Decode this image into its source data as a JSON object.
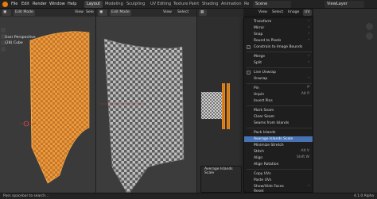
{
  "topbar": {
    "menus": [
      "File",
      "Edit",
      "Render",
      "Window",
      "Help"
    ],
    "workspaces": [
      "Layout",
      "Modeling",
      "Sculpting",
      "UV Editing",
      "Texture Paint",
      "Shading",
      "Animation",
      "Re"
    ],
    "active_workspace": "Layout",
    "scene": "Scene",
    "view_layer": "ViewLayer"
  },
  "viewport_left": {
    "mode": "Edit Mode",
    "view_label": "View",
    "select_label": "Sele",
    "overlay_line1": "User Perspective",
    "overlay_line2": "(28) Cube"
  },
  "viewport_mid": {
    "mode": "Edit Mode",
    "view_label": "View",
    "select_label": "Select"
  },
  "uv_editor": {
    "view_label": "View",
    "select_label": "Select",
    "image_label": "Image",
    "uv_label": "UV"
  },
  "uv_menu": {
    "items": [
      {
        "label": "Transform",
        "submenu": true
      },
      {
        "label": "Mirror",
        "submenu": true
      },
      {
        "label": "Snap",
        "submenu": true
      },
      {
        "label": "Round to Pixels"
      },
      {
        "label": "Constrain to Image Bounds",
        "checkbox": true
      },
      {
        "label": "Merge",
        "submenu": true
      },
      {
        "label": "Split",
        "submenu": true
      },
      {
        "label": "Live Unwrap",
        "checkbox": true
      },
      {
        "label": "Unwrap",
        "submenu": true
      },
      {
        "label": "Pin",
        "shortcut": "P"
      },
      {
        "label": "Unpin",
        "shortcut": "Alt P"
      },
      {
        "label": "Invert Pins"
      },
      {
        "label": "Mark Seam"
      },
      {
        "label": "Clear Seam"
      },
      {
        "label": "Seams from Islands"
      },
      {
        "label": "Pack Islands"
      },
      {
        "label": "Average Islands Scale",
        "highlighted": true
      },
      {
        "label": "Minimize Stretch"
      },
      {
        "label": "Stitch",
        "shortcut": "Alt V"
      },
      {
        "label": "Align",
        "shortcut": "Shift W"
      },
      {
        "label": "Align Rotation"
      },
      {
        "label": "Copy UVs"
      },
      {
        "label": "Paste UVs"
      },
      {
        "label": "Show/Hide Faces",
        "submenu": true
      },
      {
        "label": "Reset"
      }
    ]
  },
  "redo_panel": {
    "title": "Average Islands Scale"
  },
  "status": {
    "left": "Pass spacebar to search...",
    "right": "4.1.0 Alpha"
  },
  "colors": {
    "accent": "#e87d0d",
    "highlight": "#4772b3"
  }
}
